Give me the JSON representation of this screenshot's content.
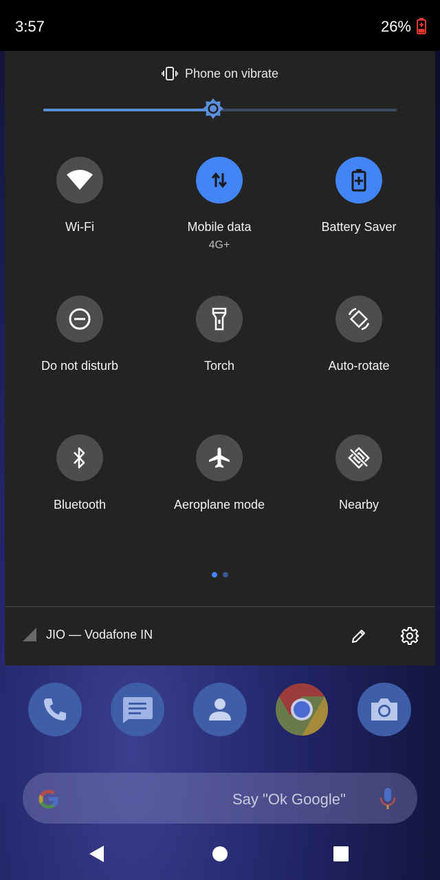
{
  "status_bar": {
    "time": "3:57",
    "battery_percent": "26%",
    "battery_icon": "battery-charging-low-icon"
  },
  "quick_settings": {
    "header": {
      "text": "Phone on vibrate",
      "icon": "vibrate-icon"
    },
    "brightness": {
      "level": 0.48,
      "icon": "brightness-icon"
    },
    "tiles": [
      {
        "label": "Wi-Fi",
        "icon": "wifi-icon",
        "active": false
      },
      {
        "label": "Mobile data",
        "sub": "4G+",
        "icon": "mobile-data-icon",
        "active": true
      },
      {
        "label": "Battery Saver",
        "icon": "battery-saver-icon",
        "active": true
      },
      {
        "label": "Do not disturb",
        "icon": "do-not-disturb-icon",
        "active": false
      },
      {
        "label": "Torch",
        "icon": "torch-icon",
        "active": false
      },
      {
        "label": "Auto-rotate",
        "icon": "auto-rotate-icon",
        "active": false
      },
      {
        "label": "Bluetooth",
        "icon": "bluetooth-icon",
        "active": false
      },
      {
        "label": "Aeroplane mode",
        "icon": "aeroplane-icon",
        "active": false
      },
      {
        "label": "Nearby",
        "icon": "nearby-icon",
        "active": false
      }
    ],
    "page_indicator": {
      "current": 1,
      "total": 2
    },
    "footer": {
      "carrier": "JIO — Vodafone IN",
      "edit_icon": "edit-icon",
      "settings_icon": "settings-icon"
    }
  },
  "dock": [
    "phone-icon",
    "messages-icon",
    "contacts-icon",
    "chrome-icon",
    "camera-icon"
  ],
  "search": {
    "hint": "Say \"Ok Google\"",
    "logo": "google-g-icon",
    "mic": "mic-icon"
  },
  "nav": [
    "back-icon",
    "home-icon",
    "recents-icon"
  ],
  "colors": {
    "accent": "#4285f4",
    "panel": "#232323",
    "tile_off": "#4d4d4d"
  }
}
